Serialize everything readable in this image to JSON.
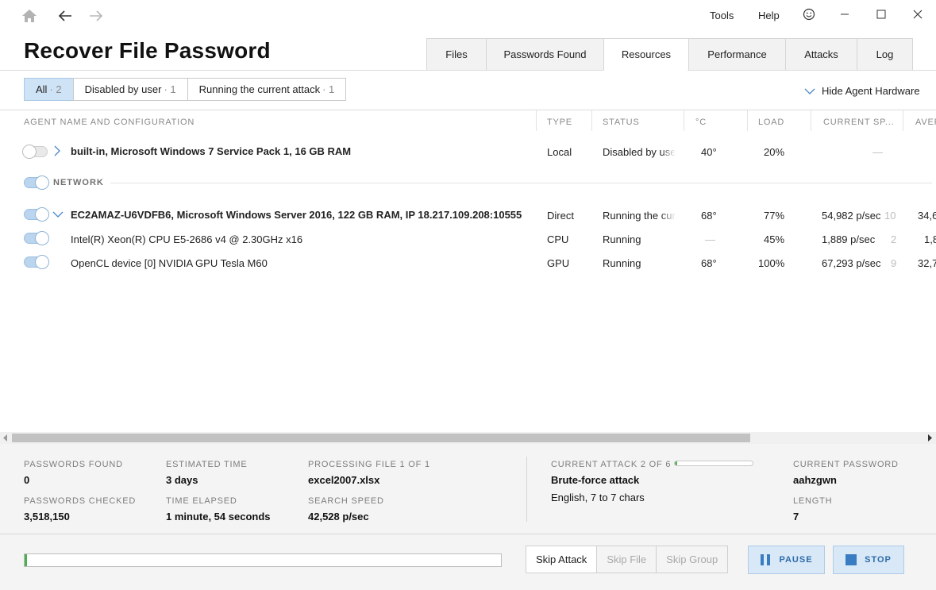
{
  "menu": {
    "tools": "Tools",
    "help": "Help"
  },
  "app_title": "Recover File Password",
  "tabs": [
    "Files",
    "Passwords Found",
    "Resources",
    "Performance",
    "Attacks",
    "Log"
  ],
  "active_tab": "Resources",
  "filters": [
    {
      "label": "All",
      "count": "· 2",
      "active": true
    },
    {
      "label": "Disabled by user",
      "count": "· 1",
      "active": false
    },
    {
      "label": "Running the current attack",
      "count": "· 1",
      "active": false
    }
  ],
  "hide_agent_hardware": "Hide Agent Hardware",
  "columns": {
    "name": "AGENT NAME AND CONFIGURATION",
    "type": "TYPE",
    "status": "STATUS",
    "temp": "°C",
    "load": "LOAD",
    "current_speed": "CURRENT SP...",
    "average": "AVER"
  },
  "rows": {
    "builtin": {
      "name": "built-in, Microsoft Windows 7 Service Pack 1, 16 GB RAM",
      "type": "Local",
      "status": "Disabled by user",
      "temp": "40°",
      "load": "20%",
      "speed": "—",
      "speed_extra": "",
      "avg": "",
      "enabled": false
    },
    "group_label": "NETWORK",
    "agent": {
      "name": "EC2AMAZ-U6VDFB6, Microsoft Windows Server 2016, 122 GB RAM, IP 18.217.109.208:10555",
      "type": "Direct",
      "status": "Running the current attack",
      "temp": "68°",
      "load": "77%",
      "speed": "54,982 p/sec",
      "speed_extra": "10",
      "avg": "34,6",
      "enabled": true
    },
    "cpu": {
      "name": "Intel(R) Xeon(R) CPU E5-2686 v4 @ 2.30GHz x16",
      "type": "CPU",
      "status": "Running",
      "temp": "—",
      "load": "45%",
      "speed": "1,889 p/sec",
      "speed_extra": "2",
      "avg": "1,8",
      "enabled": true
    },
    "gpu": {
      "name": "OpenCL device [0] NVIDIA GPU Tesla M60",
      "type": "GPU",
      "status": "Running",
      "temp": "68°",
      "load": "100%",
      "speed": "67,293 p/sec",
      "speed_extra": "9",
      "avg": "32,7",
      "enabled": true
    }
  },
  "stats": {
    "passwords_found_label": "PASSWORDS FOUND",
    "passwords_found": "0",
    "passwords_checked_label": "PASSWORDS CHECKED",
    "passwords_checked": "3,518,150",
    "estimated_time_label": "ESTIMATED TIME",
    "estimated_time": "3 days",
    "time_elapsed_label": "TIME ELAPSED",
    "time_elapsed": "1 minute, 54 seconds",
    "processing_file_label": "PROCESSING FILE 1 OF 1",
    "processing_file": "excel2007.xlsx",
    "search_speed_label": "SEARCH SPEED",
    "search_speed": "42,528 p/sec",
    "current_attack_label": "CURRENT ATTACK 2 OF 6",
    "current_attack": "Brute-force attack",
    "attack_details": "English, 7 to 7 chars",
    "attack_progress": 0.03,
    "current_password_label": "CURRENT PASSWORD",
    "current_password": "aahzgwn",
    "length_label": "LENGTH",
    "length": "7"
  },
  "overall_progress": 0.005,
  "actions": {
    "skip_attack": "Skip Attack",
    "skip_file": "Skip File",
    "skip_group": "Skip Group",
    "pause": "PAUSE",
    "stop": "STOP"
  },
  "colors": {
    "accent": "#2d6ca8",
    "toggle_on": "#bcd5ee",
    "progress": "#4caf50",
    "active_filter": "#cfe3f6"
  }
}
